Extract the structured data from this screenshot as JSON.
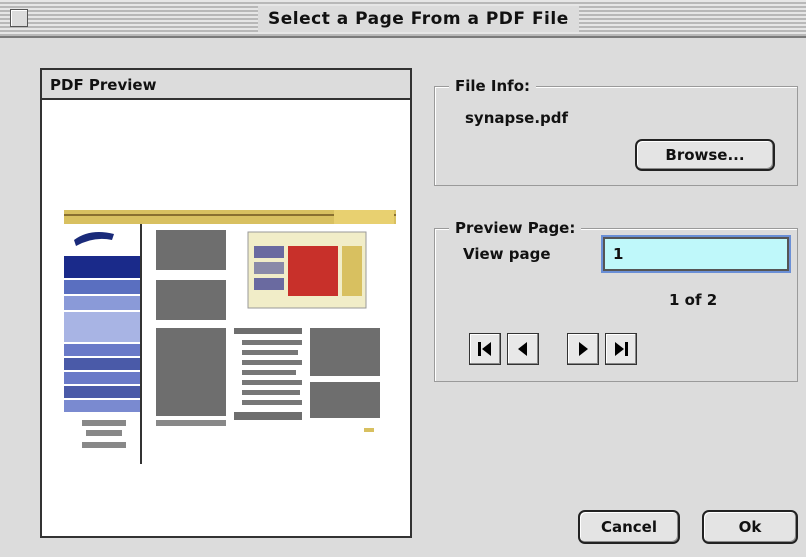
{
  "window": {
    "title": "Select a Page From a PDF File"
  },
  "preview": {
    "header": "PDF Preview"
  },
  "file_info": {
    "title": "File Info:",
    "filename": "synapse.pdf",
    "browse_label": "Browse..."
  },
  "preview_page": {
    "title": "Preview Page:",
    "view_page_label": "View page",
    "page_value": "1",
    "page_count": "1 of 2",
    "nav_icons": [
      "first-page-icon",
      "prev-page-icon",
      "next-page-icon",
      "last-page-icon"
    ]
  },
  "buttons": {
    "cancel": "Cancel",
    "ok": "Ok"
  },
  "colors": {
    "window_bg": "#dcdcdc",
    "input_bg": "#bff8fa",
    "focus_ring": "#6a8fd6",
    "thumb_nav_bar": "#d8c060",
    "thumb_sidebar": "#3a4fa0",
    "thumb_block": "#6e6e6e",
    "thumb_red": "#c8302a"
  }
}
